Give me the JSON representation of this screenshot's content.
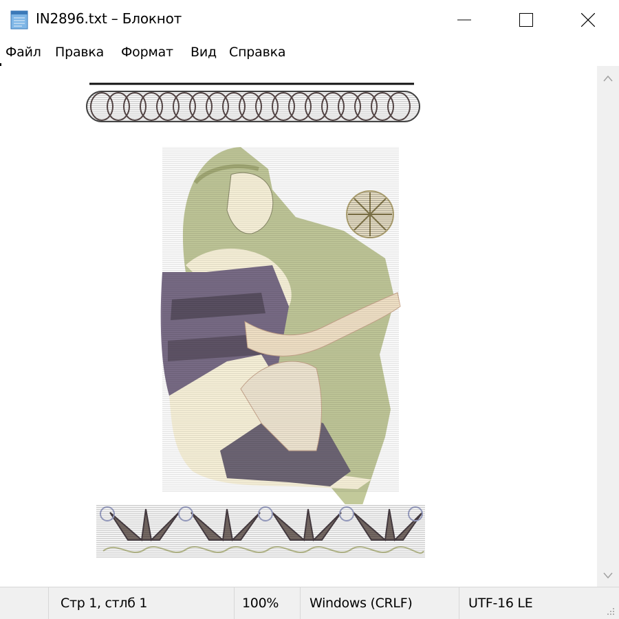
{
  "window": {
    "title": "IN2896.txt – Блокнот",
    "controls": {
      "minimize": "minimize",
      "maximize": "maximize",
      "close": "close"
    }
  },
  "menu": [
    "Файл",
    "Правка",
    "Формат",
    "Вид",
    "Справка"
  ],
  "document": {
    "content_icons": [
      "chain-border",
      "woman-figure",
      "sun-disc",
      "palmette-border"
    ]
  },
  "status": {
    "position": "Стр 1, стлб 1",
    "zoom": "100%",
    "line_endings": "Windows (CRLF)",
    "encoding": "UTF-16 LE"
  },
  "colors": {
    "titlebar": "#ffffff",
    "statusbar": "#f0f0f0",
    "scrollbar": "#f0f0f0",
    "hair": "#b9c28f",
    "skin": "#fbf4dc",
    "robe": "#7a6d87",
    "robe_dark": "#4d4552"
  }
}
